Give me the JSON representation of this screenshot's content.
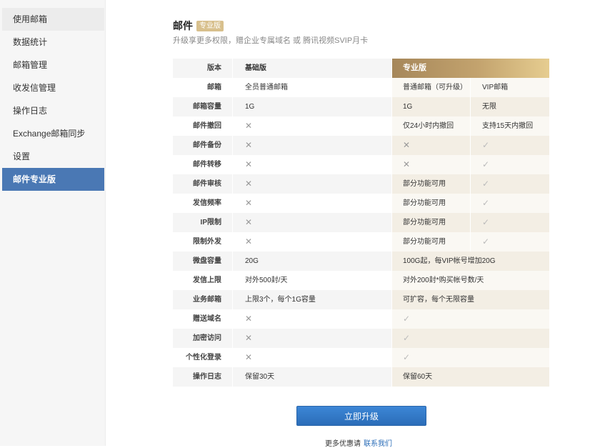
{
  "sidebar": {
    "items": [
      {
        "label": "使用邮箱"
      },
      {
        "label": "数据统计"
      },
      {
        "label": "邮箱管理"
      },
      {
        "label": "收发信管理"
      },
      {
        "label": "操作日志"
      },
      {
        "label": "Exchange邮箱同步"
      },
      {
        "label": "设置"
      },
      {
        "label": "邮件专业版"
      }
    ],
    "active_index": 7
  },
  "header": {
    "title": "邮件",
    "badge": "专业版",
    "subtitle": "升级享更多权限，赠企业专属域名 或 腾讯视频SVIP月卡"
  },
  "table": {
    "head": {
      "label": "版本",
      "basic": "基础版",
      "pro": "专业版"
    },
    "rows": [
      {
        "label": "邮箱",
        "basic": "全员普通邮箱",
        "pro1": "普通邮箱（可升级）",
        "pro2": "VIP邮箱"
      },
      {
        "label": "邮箱容量",
        "basic": "1G",
        "pro1": "1G",
        "pro2": "无限"
      },
      {
        "label": "邮件撤回",
        "basic": "✕",
        "pro1": "仅24小时内撤回",
        "pro2": "支持15天内撤回"
      },
      {
        "label": "邮件备份",
        "basic": "✕",
        "pro1": "✕",
        "pro2": "✓"
      },
      {
        "label": "邮件转移",
        "basic": "✕",
        "pro1": "✕",
        "pro2": "✓"
      },
      {
        "label": "邮件审核",
        "basic": "✕",
        "pro1": "部分功能可用",
        "pro2": "✓"
      },
      {
        "label": "发信频率",
        "basic": "✕",
        "pro1": "部分功能可用",
        "pro2": "✓"
      },
      {
        "label": "IP限制",
        "basic": "✕",
        "pro1": "部分功能可用",
        "pro2": "✓"
      },
      {
        "label": "限制外发",
        "basic": "✕",
        "pro1": "部分功能可用",
        "pro2": "✓"
      },
      {
        "label": "微盘容量",
        "basic": "20G",
        "pro": "100G起，每VIP帐号增加20G"
      },
      {
        "label": "发信上限",
        "basic": "对外500封/天",
        "pro": "对外200封*购买帐号数/天"
      },
      {
        "label": "业务邮箱",
        "basic": "上限3个，每个1G容量",
        "pro": "可扩容，每个无限容量"
      },
      {
        "label": "赠送域名",
        "basic": "✕",
        "pro": "✓"
      },
      {
        "label": "加密访问",
        "basic": "✕",
        "pro": "✓"
      },
      {
        "label": "个性化登录",
        "basic": "✕",
        "pro": "✓"
      },
      {
        "label": "操作日志",
        "basic": "保留30天",
        "pro": "保留60天"
      }
    ]
  },
  "actions": {
    "upgrade_label": "立即升级"
  },
  "footer": {
    "text": "更多优惠请",
    "link": "联系我们"
  },
  "colors": {
    "accent": "#4a78b4",
    "pro_gold": "#c3a36e",
    "button": "#2b6db8"
  }
}
